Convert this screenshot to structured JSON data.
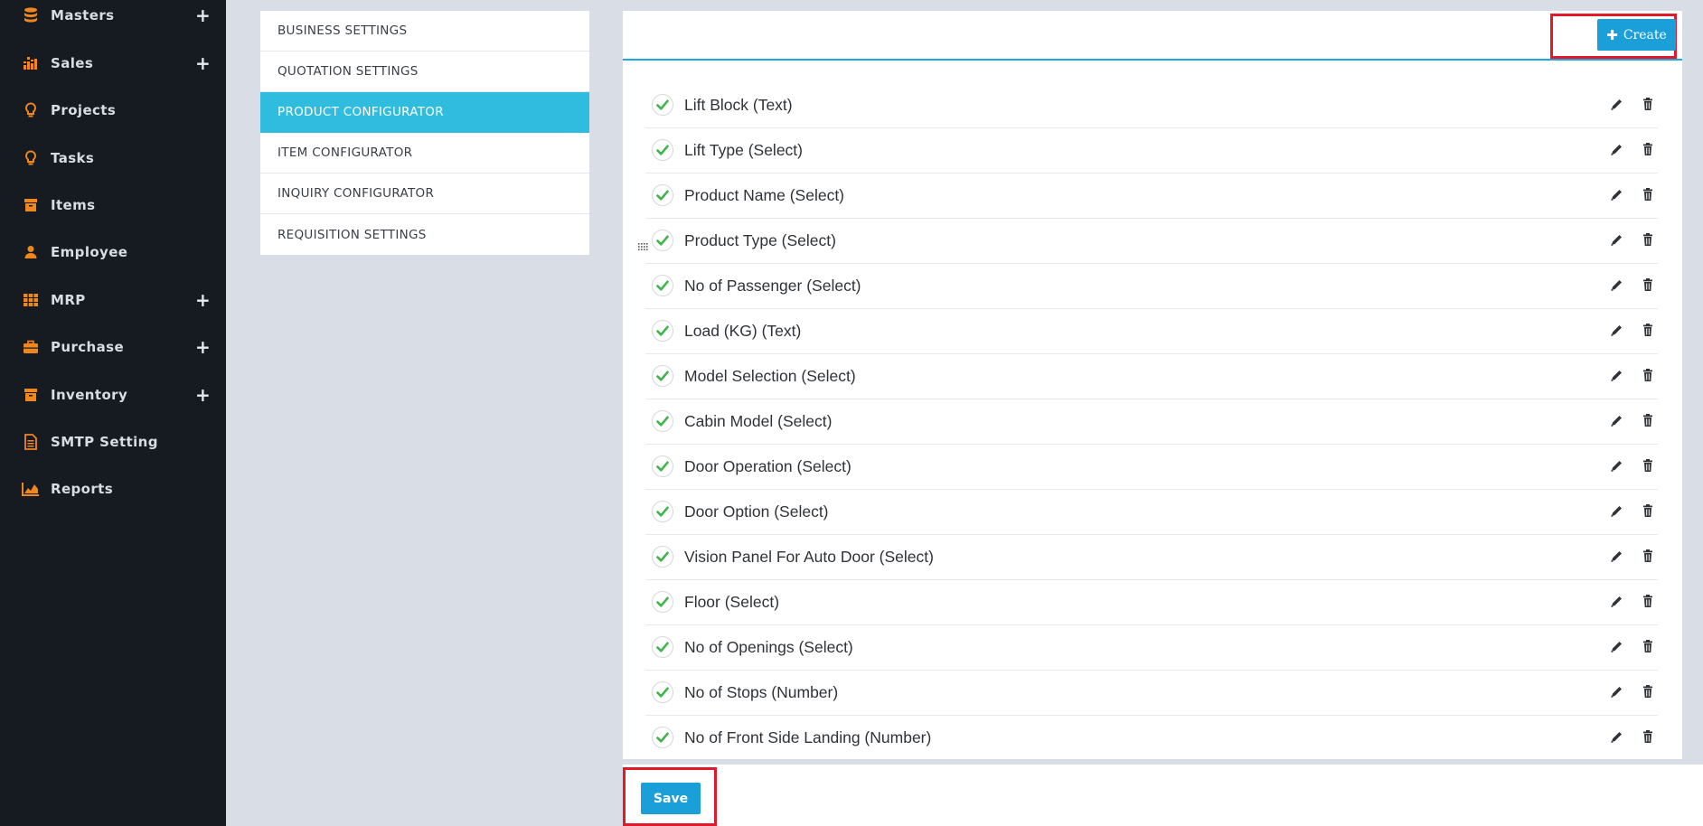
{
  "sidebar": {
    "items": [
      {
        "label": "Masters",
        "icon": "database-icon",
        "expandable": true
      },
      {
        "label": "Sales",
        "icon": "bar-chart-icon",
        "expandable": true
      },
      {
        "label": "Projects",
        "icon": "lightbulb-icon",
        "expandable": false
      },
      {
        "label": "Tasks",
        "icon": "lightbulb-icon",
        "expandable": false
      },
      {
        "label": "Items",
        "icon": "archive-box-icon",
        "expandable": false
      },
      {
        "label": "Employee",
        "icon": "user-icon",
        "expandable": false
      },
      {
        "label": "MRP",
        "icon": "grid-icon",
        "expandable": true
      },
      {
        "label": "Purchase",
        "icon": "briefcase-icon",
        "expandable": true
      },
      {
        "label": "Inventory",
        "icon": "archive-box-icon",
        "expandable": true
      },
      {
        "label": "SMTP Setting",
        "icon": "document-icon",
        "expandable": false
      },
      {
        "label": "Reports",
        "icon": "area-chart-icon",
        "expandable": false
      }
    ],
    "expand_glyph": "+",
    "icon_color": "#f0861e"
  },
  "settings_menu": {
    "items": [
      {
        "label": "BUSINESS SETTINGS",
        "active": false
      },
      {
        "label": "QUOTATION SETTINGS",
        "active": false
      },
      {
        "label": "PRODUCT CONFIGURATOR",
        "active": true
      },
      {
        "label": "ITEM CONFIGURATOR",
        "active": false
      },
      {
        "label": "INQUIRY CONFIGURATOR",
        "active": false
      },
      {
        "label": "REQUISITION SETTINGS",
        "active": false
      }
    ],
    "active_color": "#2fbcde"
  },
  "toolbar": {
    "create_label": "Create",
    "create_icon": "plus-icon",
    "save_label": "Save"
  },
  "fields": [
    {
      "label": "Lift Block (Text)",
      "enabled": true
    },
    {
      "label": "Lift Type (Select)",
      "enabled": true
    },
    {
      "label": "Product Name (Select)",
      "enabled": true
    },
    {
      "label": "Product Type (Select)",
      "enabled": true
    },
    {
      "label": "No of Passenger (Select)",
      "enabled": true
    },
    {
      "label": "Load (KG) (Text)",
      "enabled": true
    },
    {
      "label": "Model Selection (Select)",
      "enabled": true
    },
    {
      "label": "Cabin Model (Select)",
      "enabled": true
    },
    {
      "label": "Door Operation (Select)",
      "enabled": true
    },
    {
      "label": "Door Option (Select)",
      "enabled": true
    },
    {
      "label": "Vision Panel For Auto Door (Select)",
      "enabled": true
    },
    {
      "label": "Floor (Select)",
      "enabled": true
    },
    {
      "label": "No of Openings (Select)",
      "enabled": true
    },
    {
      "label": "No of Stops (Number)",
      "enabled": true
    },
    {
      "label": "No of Front Side Landing (Number)",
      "enabled": true
    }
  ],
  "colors": {
    "accent": "#1a9fd9",
    "check": "#3cb54a",
    "highlight": "#e1192b"
  }
}
